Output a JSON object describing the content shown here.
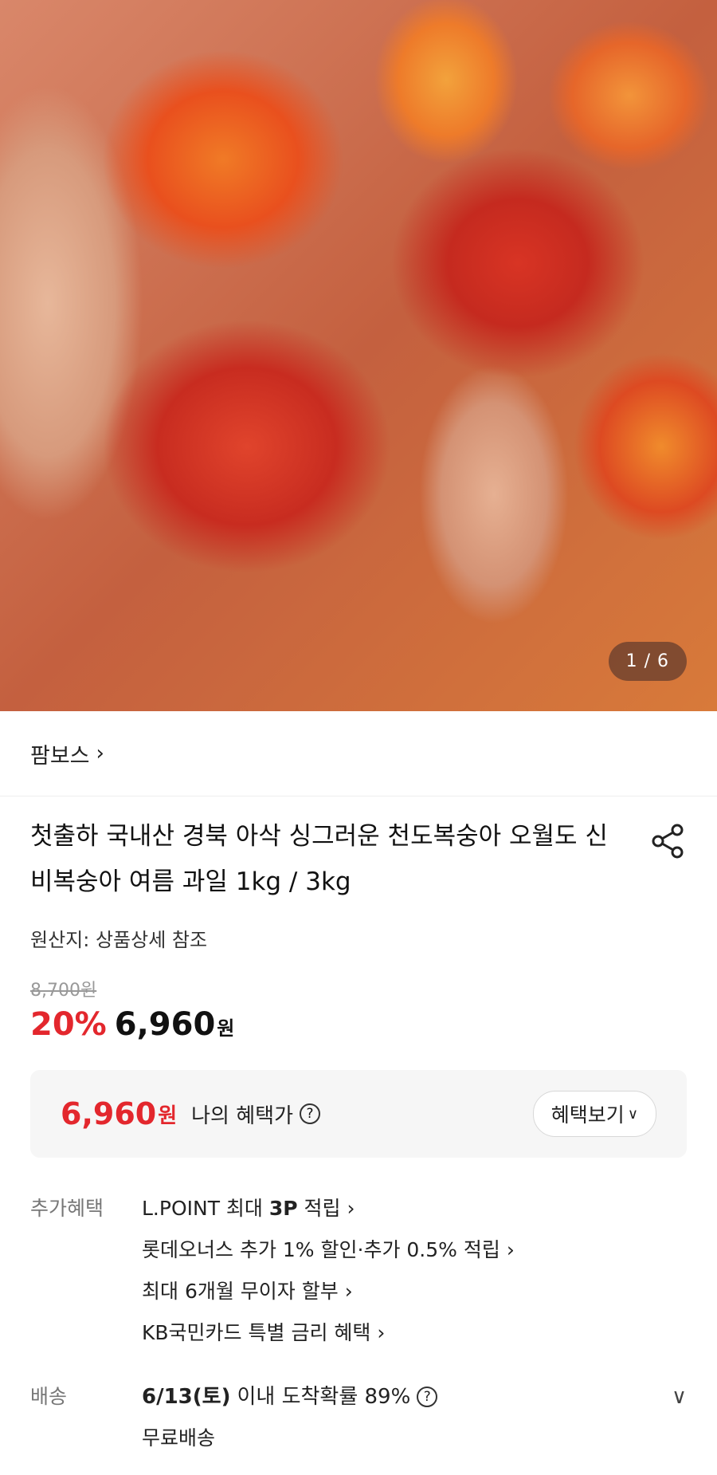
{
  "hero": {
    "image_alt": "peaches held in hand",
    "counter_current": "1",
    "counter_total": "6"
  },
  "brand": {
    "name": "팜보스"
  },
  "product": {
    "title": "첫출하 국내산 경북 아삭 싱그러운 천도복숭아 오월도 신비복숭아 여름 과일 1kg / 3kg",
    "origin": "원산지: 상품상세 참조"
  },
  "pricing": {
    "original": "8,700원",
    "discount": "20%",
    "price": "6,960",
    "currency": "원"
  },
  "benefit": {
    "price": "6,960",
    "currency": "원",
    "label": "나의 혜택가",
    "button_label": "혜택보기"
  },
  "extra_benefits": {
    "label": "추가혜택",
    "items": [
      {
        "prefix": "L.POINT 최대 ",
        "bold": "3P",
        "suffix": " 적립"
      },
      {
        "text": "롯데오너스 추가 1% 할인·추가 0.5% 적립"
      },
      {
        "text": "최대 6개월 무이자 할부"
      },
      {
        "text": "KB국민카드 특별 금리 혜택"
      }
    ]
  },
  "delivery": {
    "label": "배송",
    "date": "6/13(토)",
    "text": "이내 도착확률 89%",
    "free": "무료배송"
  },
  "icons": {
    "share": "share-icon",
    "help": "question-circle-icon",
    "chevron_right": "chevron-right-icon",
    "chevron_down": "chevron-down-icon"
  },
  "colors": {
    "accent_red": "#e3272d",
    "benefit_bg": "#f6f6f6"
  }
}
